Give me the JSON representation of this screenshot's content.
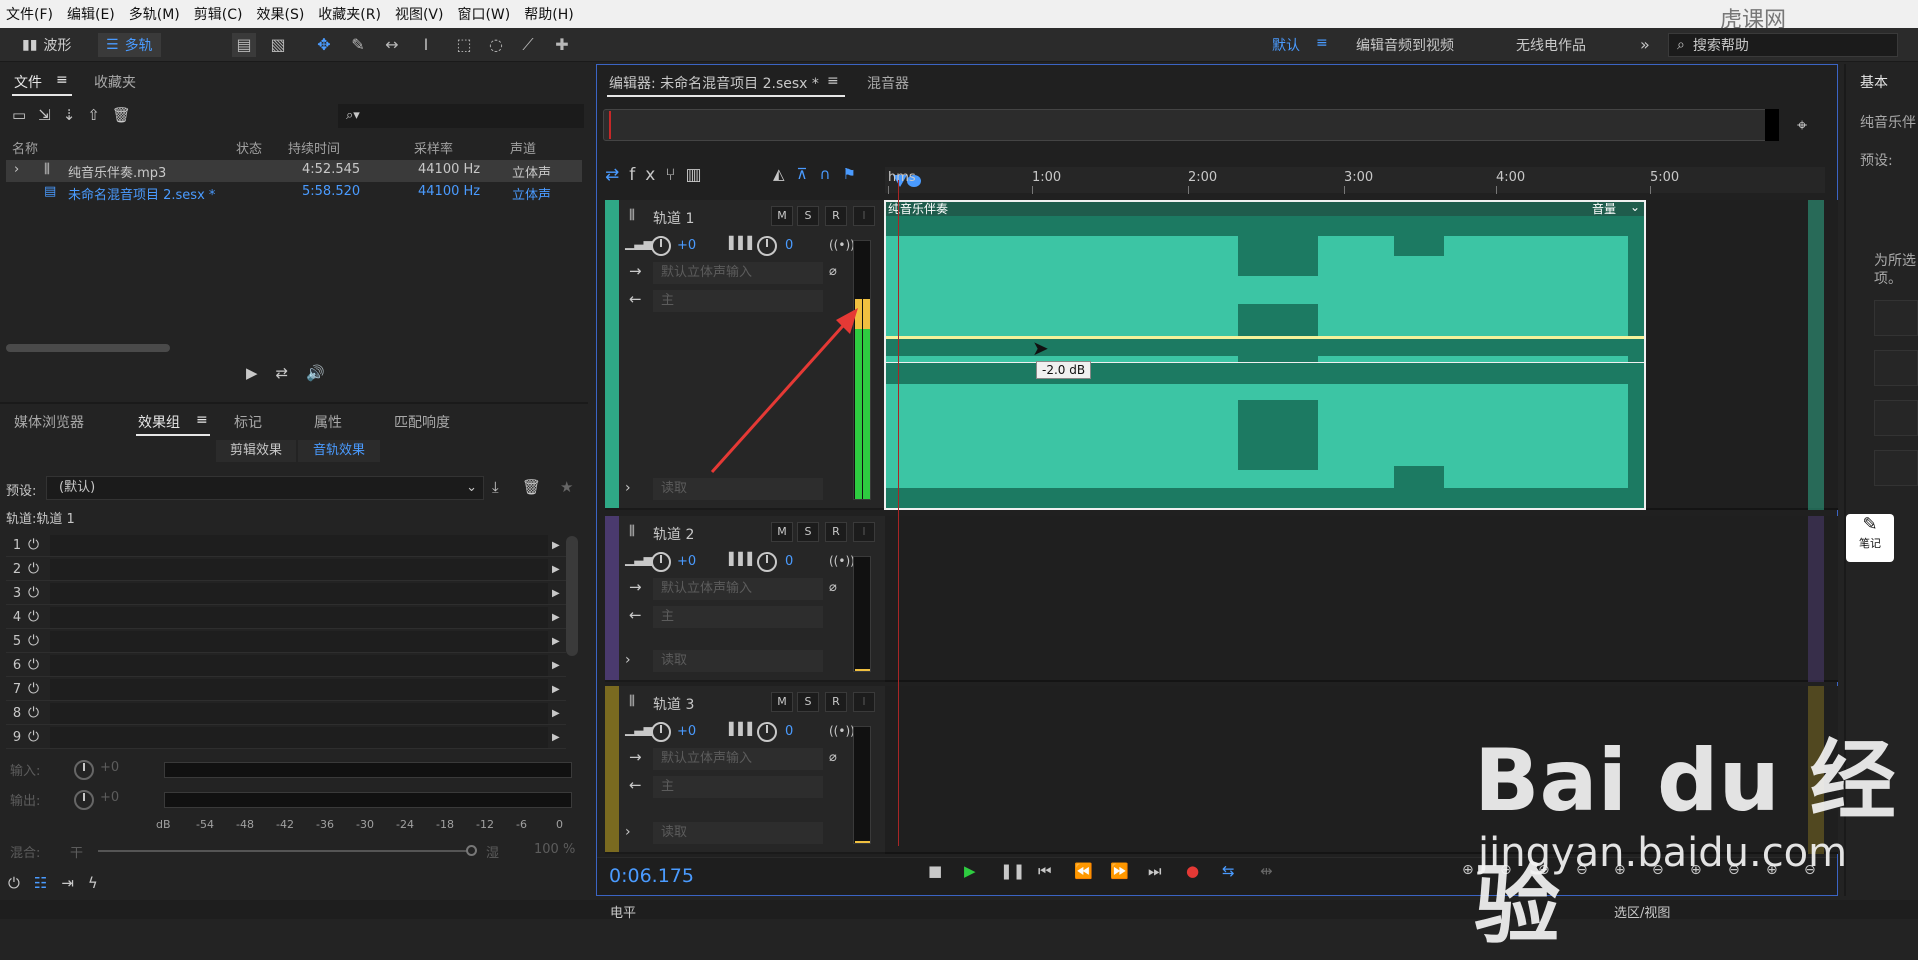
{
  "menu": [
    "文件(F)",
    "编辑(E)",
    "多轨(M)",
    "剪辑(C)",
    "效果(S)",
    "收藏夹(R)",
    "视图(V)",
    "窗口(W)",
    "帮助(H)"
  ],
  "toolbar": {
    "waveform_label": "波形",
    "multitrack_label": "多轨"
  },
  "workspaces": {
    "default": "默认",
    "edit_audio_video": "编辑音频到视频",
    "radio": "无线电作品",
    "more": "»"
  },
  "search": {
    "placeholder": "搜索帮助"
  },
  "files_panel": {
    "tabs": [
      "文件",
      "收藏夹"
    ],
    "columns": [
      "名称",
      "状态",
      "持续时间",
      "采样率",
      "声道"
    ],
    "rows": [
      {
        "name": "纯音乐伴奏.mp3",
        "status": "",
        "duration": "4:52.545",
        "rate": "44100 Hz",
        "channels": "立体声"
      },
      {
        "name": "未命名混音项目 2.sesx *",
        "status": "",
        "duration": "5:58.520",
        "rate": "44100 Hz",
        "channels": "立体声"
      }
    ]
  },
  "effects_panel": {
    "tabs": [
      "媒体浏览器",
      "效果组",
      "标记",
      "属性",
      "匹配响度"
    ],
    "subtabs": [
      "剪辑效果",
      "音轨效果"
    ],
    "preset_label": "预设:",
    "preset_value": "(默认)",
    "target_label": "轨道:轨道 1",
    "slots": [
      "1",
      "2",
      "3",
      "4",
      "5",
      "6",
      "7",
      "8",
      "9"
    ],
    "input_label": "输入:",
    "input_value": "+0",
    "output_label": "输出:",
    "output_value": "+0",
    "scale": [
      "dB",
      "-54",
      "-48",
      "-42",
      "-36",
      "-30",
      "-24",
      "-18",
      "-12",
      "-6",
      "0"
    ],
    "mix_label": "混合:",
    "dry_label": "干",
    "wet_label": "湿",
    "mix_value": "100 %"
  },
  "editor": {
    "tab_title": "编辑器: 未命名混音项目 2.sesx *",
    "mixer_tab": "混音器",
    "ruler": [
      "hms",
      "1:00",
      "2:00",
      "3:00",
      "4:00",
      "5:00"
    ],
    "clip_name": "纯音乐伴奏",
    "clip_volume": "音量",
    "tooltip": "-2.0 dB",
    "time": "0:06.175",
    "tracks": [
      {
        "name": "轨道 1",
        "vol": "+0",
        "pan": "0",
        "input": "默认立体声输入",
        "output": "主",
        "mode": "读取",
        "color": "#2fa886"
      },
      {
        "name": "轨道 2",
        "vol": "+0",
        "pan": "0",
        "input": "默认立体声输入",
        "output": "主",
        "mode": "读取",
        "color": "#4a3a6e"
      },
      {
        "name": "轨道 3",
        "vol": "+0",
        "pan": "0",
        "input": "默认立体声输入",
        "output": "主",
        "mode": "读取",
        "color": "#7a6a20"
      }
    ]
  },
  "right_panel": {
    "title": "基本",
    "item": "纯音乐伴",
    "preset": "预设:",
    "hint1": "为所选",
    "hint2": "项。",
    "notes": "笔记"
  },
  "bottom": {
    "level": "电平",
    "selection": "选区/视图"
  },
  "watermark": {
    "brand": "Bai du 经验",
    "url": "jingyan.baidu.com",
    "corner": "虎课网"
  }
}
